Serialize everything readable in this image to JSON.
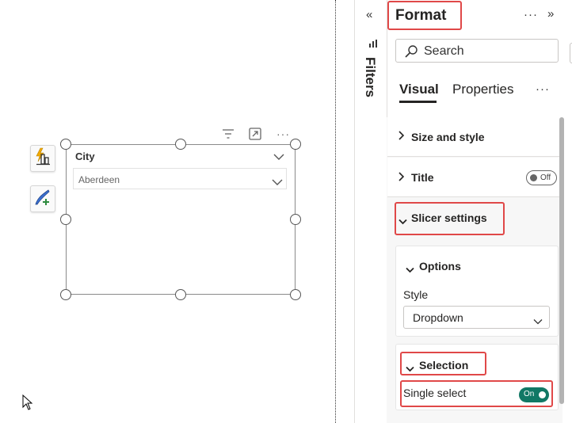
{
  "canvas": {
    "slicer": {
      "title": "City",
      "selected_value": "Aberdeen"
    },
    "header_icons": [
      "filter-icon",
      "focus-mode-icon",
      "more-options-icon"
    ],
    "side_buttons": [
      "build-visual-icon",
      "format-visual-icon"
    ]
  },
  "filters": {
    "label": "Filters",
    "collapse_glyph": "«"
  },
  "format_pane": {
    "title": "Format",
    "more_glyph": "···",
    "expand_glyph": "»",
    "search_placeholder": "Search",
    "tabs": [
      {
        "label": "Visual",
        "active": true
      },
      {
        "label": "Properties",
        "active": false
      }
    ],
    "tabs_more": "···",
    "sections": {
      "size_and_style": "Size and style",
      "title": "Title",
      "title_toggle": "Off",
      "slicer_settings": "Slicer settings"
    },
    "options_card": {
      "header": "Options",
      "style_label": "Style",
      "style_value": "Dropdown"
    },
    "selection_card": {
      "header": "Selection",
      "single_select_label": "Single select",
      "single_select_toggle": "On"
    }
  },
  "colors": {
    "accent": "#117865",
    "highlight_box": "#e04848",
    "active_tab_underline": "#252423"
  }
}
